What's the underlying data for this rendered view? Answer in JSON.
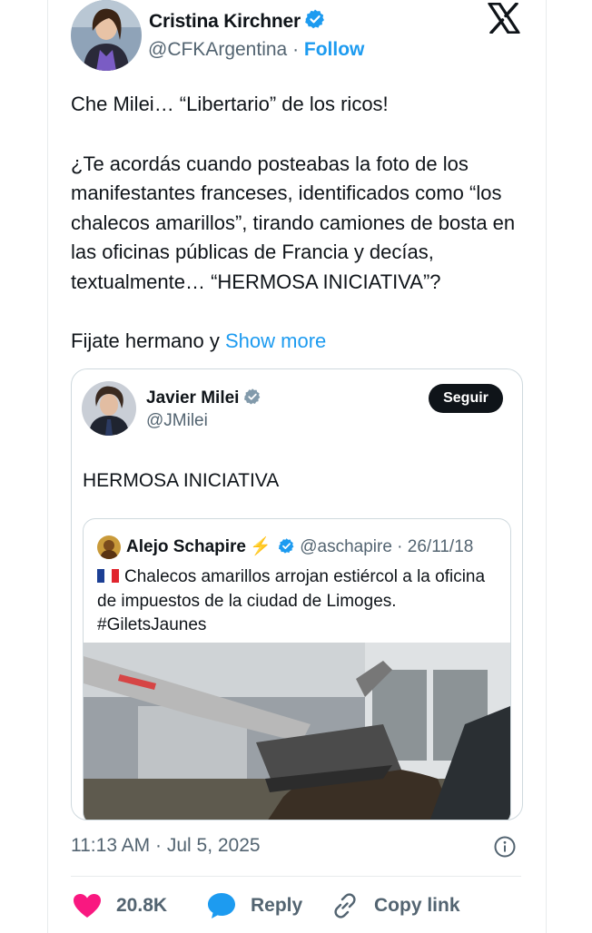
{
  "author": {
    "name": "Cristina Kirchner",
    "handle": "@CFKArgentina",
    "separator": "·",
    "follow_label": "Follow"
  },
  "tweet": {
    "paragraphs": [
      "Che Milei… “Libertario” de los ricos!",
      "¿Te acordás cuando posteabas la foto de los manifestantes franceses, identificados como “los chalecos amarillos”, tirando camiones de bosta en las oficinas públicas de Francia y decías, textualmente… “HERMOSA INICIATIVA”?",
      "Fijate hermano y"
    ],
    "show_more_label": "Show more"
  },
  "quoted": {
    "name": "Javier Milei",
    "handle": "@JMilei",
    "follow_label": "Seguir",
    "text": "HERMOSA INICIATIVA",
    "inner": {
      "name": "Alejo Schapire",
      "emoji": "⚡",
      "handle": "@aschapire",
      "date": "26/11/18",
      "text": "Chalecos amarillos arrojan estiércol a la oficina de impuestos de la ciudad de Limoges. #GiletsJaunes"
    }
  },
  "footer": {
    "timestamp": "11:13 AM · Jul 5, 2025",
    "like_count": "20.8K",
    "reply_label": "Reply",
    "copy_link_label": "Copy link"
  },
  "colors": {
    "accent": "#1d9bf0",
    "like": "#f91880",
    "text": "#0f1419",
    "secondary": "#536471"
  },
  "icons": [
    "verified-badge-icon",
    "x-logo-icon",
    "info-icon",
    "heart-icon",
    "reply-bubble-icon",
    "link-icon",
    "france-flag-icon"
  ]
}
